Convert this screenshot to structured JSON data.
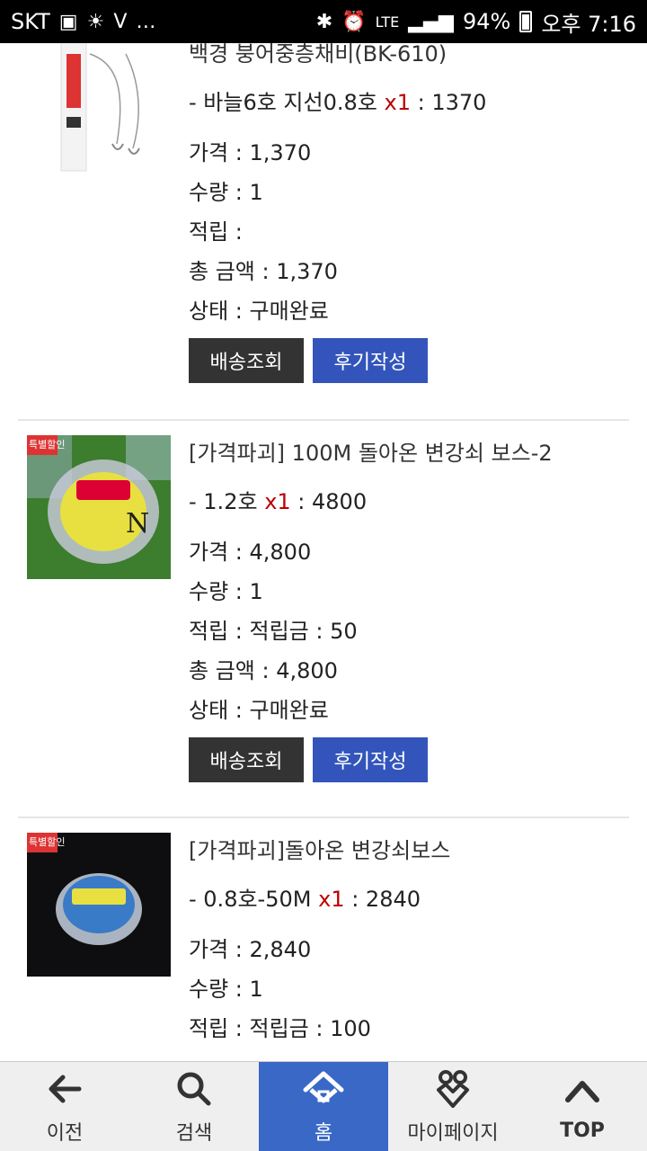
{
  "status_bar": {
    "carrier": "SKT",
    "network": "LTE",
    "battery": "94%",
    "time": "오후 7:16"
  },
  "orders": [
    {
      "title": "백경 붕어중층채비(BK-610)",
      "option_name": "- 바늘6호 지선0.8호",
      "option_qty": "x1",
      "option_price": " : 1370",
      "price": "가격 : 1,370",
      "quantity": "수량 : 1",
      "points": "적립 :",
      "total": "총 금액 : 1,370",
      "status": "상태 : 구매완료",
      "btn_shipping": "배송조회",
      "btn_review": "후기작성"
    },
    {
      "title": "[가격파괴] 100M 돌아온 변강쇠 보스-2",
      "option_name": "- 1.2호",
      "option_qty": "x1",
      "option_price": " : 4800",
      "price": "가격 : 4,800",
      "quantity": "수량 : 1",
      "points": "적립 : 적립금 : 50",
      "total": "총 금액 : 4,800",
      "status": "상태 : 구매완료",
      "btn_shipping": "배송조회",
      "btn_review": "후기작성",
      "thumb_badge": "특별할인"
    },
    {
      "title": "[가격파괴]돌아온 변강쇠보스",
      "option_name": "- 0.8호-50M",
      "option_qty": "x1",
      "option_price": " : 2840",
      "price": "가격 : 2,840",
      "quantity": "수량 : 1",
      "points": "적립 : 적립금 : 100",
      "thumb_badge": "특별할인"
    }
  ],
  "bottom_nav": [
    {
      "label": "이전",
      "icon": "back-arrow-icon"
    },
    {
      "label": "검색",
      "icon": "search-icon"
    },
    {
      "label": "홈",
      "icon": "home-icon"
    },
    {
      "label": "마이페이지",
      "icon": "people-heart-icon"
    },
    {
      "label": "TOP",
      "icon": "chevron-up-icon"
    }
  ],
  "colors": {
    "accent": "#3a68c6",
    "button_dark": "#333333",
    "button_blue": "#3355bb",
    "qty_red": "#bb0000"
  }
}
